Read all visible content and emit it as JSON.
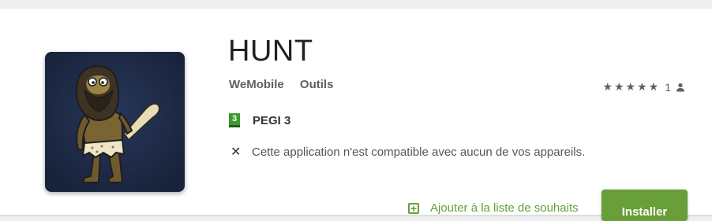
{
  "app": {
    "title": "HUNT",
    "developer": "WeMobile",
    "category": "Outils",
    "icon_name": "caveman-app-icon"
  },
  "rating": {
    "stars": "★★★★★",
    "count": "1",
    "user_icon": "person-icon"
  },
  "content_rating": {
    "badge_text": "3",
    "label": "PEGI 3"
  },
  "compatibility": {
    "icon": "close-icon",
    "message": "Cette application n'est compatible avec aucun de vos appareils."
  },
  "actions": {
    "wishlist_label": "Ajouter à la liste de souhaits",
    "install_label": "Installer"
  },
  "colors": {
    "accent": "#689f38",
    "pegi_green": "#3a9a2c",
    "icon_bg": "#1f2b47"
  }
}
